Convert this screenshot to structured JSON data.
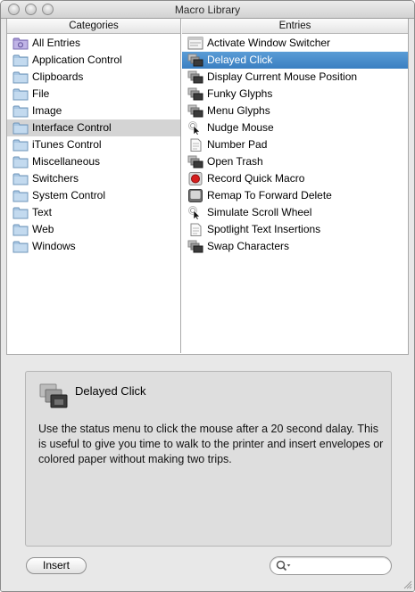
{
  "window": {
    "title": "Macro Library"
  },
  "categories": {
    "header": "Categories",
    "items": [
      {
        "label": "All Entries",
        "icon": "smart-folder-icon"
      },
      {
        "label": "Application Control",
        "icon": "folder-icon"
      },
      {
        "label": "Clipboards",
        "icon": "folder-icon"
      },
      {
        "label": "File",
        "icon": "folder-icon"
      },
      {
        "label": "Image",
        "icon": "folder-icon"
      },
      {
        "label": "Interface Control",
        "icon": "folder-icon"
      },
      {
        "label": "iTunes Control",
        "icon": "folder-icon"
      },
      {
        "label": "Miscellaneous",
        "icon": "folder-icon"
      },
      {
        "label": "Switchers",
        "icon": "folder-icon"
      },
      {
        "label": "System Control",
        "icon": "folder-icon"
      },
      {
        "label": "Text",
        "icon": "folder-icon"
      },
      {
        "label": "Web",
        "icon": "folder-icon"
      },
      {
        "label": "Windows",
        "icon": "folder-icon"
      }
    ],
    "selected": "Interface Control"
  },
  "entries": {
    "header": "Entries",
    "items": [
      {
        "label": "Activate Window Switcher",
        "icon": "window-icon"
      },
      {
        "label": "Delayed Click",
        "icon": "windows-stack-icon"
      },
      {
        "label": "Display Current Mouse Position",
        "icon": "windows-stack-icon"
      },
      {
        "label": "Funky Glyphs",
        "icon": "windows-stack-icon"
      },
      {
        "label": "Menu Glyphs",
        "icon": "windows-stack-icon"
      },
      {
        "label": "Nudge Mouse",
        "icon": "mouse-pointer-icon"
      },
      {
        "label": "Number Pad",
        "icon": "document-icon"
      },
      {
        "label": "Open Trash",
        "icon": "windows-stack-icon"
      },
      {
        "label": "Record Quick Macro",
        "icon": "record-icon"
      },
      {
        "label": "Remap To Forward Delete",
        "icon": "keyboard-key-icon"
      },
      {
        "label": "Simulate Scroll Wheel",
        "icon": "mouse-pointer-icon"
      },
      {
        "label": "Spotlight Text Insertions",
        "icon": "document-icon"
      },
      {
        "label": "Swap Characters",
        "icon": "windows-stack-icon"
      }
    ],
    "selected": "Delayed Click"
  },
  "detail": {
    "name": "Delayed Click",
    "icon": "windows-stack-icon",
    "description": "Use the status menu to click the mouse after a 20 second dalay. This is useful to give you time to walk to the printer and insert envelopes or colored paper without making two trips."
  },
  "footer": {
    "insert_label": "Insert",
    "search_placeholder": "",
    "search_value": ""
  },
  "colors": {
    "selection_blue": "#3a7fc1",
    "selection_gray": "#d4d4d4"
  }
}
